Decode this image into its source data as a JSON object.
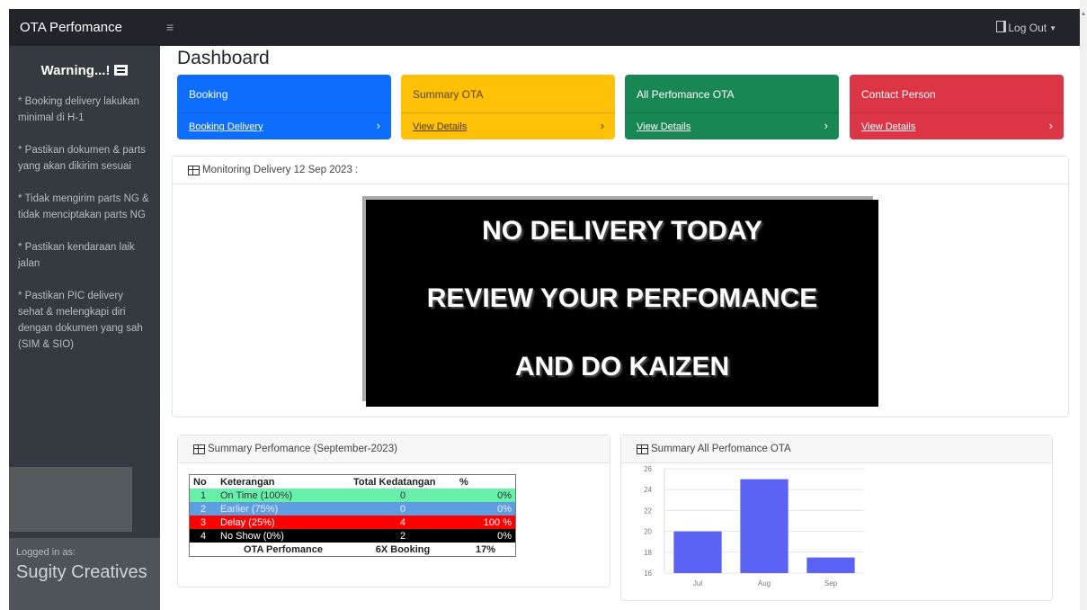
{
  "sidebar": {
    "brand": "OTA Perfomance",
    "warning_title": "Warning...!",
    "warnings": [
      "* Booking delivery lakukan minimal di H-1",
      "* Pastikan dokumen & parts yang akan dikirim sesuai",
      "* Tidak mengirim parts NG & tidak menciptakan parts NG",
      "* Pastikan kendaraan laik jalan",
      "* Pastikan PIC delivery sehat & melengkapi diri dengan dokumen yang sah (SIM & SIO)"
    ],
    "logged_in_label": "Logged in as:",
    "user_name": "Sugity Creatives"
  },
  "navbar": {
    "menu_icon": "hamburger-icon",
    "logout_label": "Log Out"
  },
  "page_title": "Dashboard",
  "cards": [
    {
      "title": "Booking",
      "link": "Booking Delivery",
      "color": "#0d6efd"
    },
    {
      "title": "Summary OTA",
      "link": "View Details",
      "color": "#ffc107"
    },
    {
      "title": "All Perfomance OTA",
      "link": "View Details",
      "color": "#198754"
    },
    {
      "title": "Contact Person",
      "link": "View Details",
      "color": "#dc3545"
    }
  ],
  "monitoring": {
    "title": "Monitoring Delivery 12 Sep 2023 :",
    "banner_lines": [
      "NO DELIVERY TODAY",
      "REVIEW YOUR PERFOMANCE",
      "AND DO KAIZEN"
    ]
  },
  "summary_perf": {
    "title": "Summary Perfomance (September-2023)",
    "headers": [
      "No",
      "Keterangan",
      "Total Kedatangan",
      "%"
    ],
    "rows": [
      {
        "no": "1",
        "label": "On Time (100%)",
        "total": "0",
        "pct": "0%"
      },
      {
        "no": "2",
        "label": "Earlier (75%)",
        "total": "0",
        "pct": "0%"
      },
      {
        "no": "3",
        "label": "Delay (25%)",
        "total": "4",
        "pct": "100 %"
      },
      {
        "no": "4",
        "label": "No Show (0%)",
        "total": "2",
        "pct": "0%"
      }
    ],
    "footer": {
      "label": "OTA Perfomance",
      "total": "6X Booking",
      "pct": "17%"
    }
  },
  "summary_all": {
    "title": "Summary All Perfomance OTA"
  },
  "chart_data": {
    "type": "bar",
    "categories": [
      "Jul",
      "Aug",
      "Sep"
    ],
    "values": [
      20,
      25,
      17.5
    ],
    "ylim": [
      16,
      26
    ],
    "yticks": [
      16,
      18,
      20,
      22,
      24,
      26
    ],
    "bar_color": "#5b63f5",
    "grid": true
  }
}
